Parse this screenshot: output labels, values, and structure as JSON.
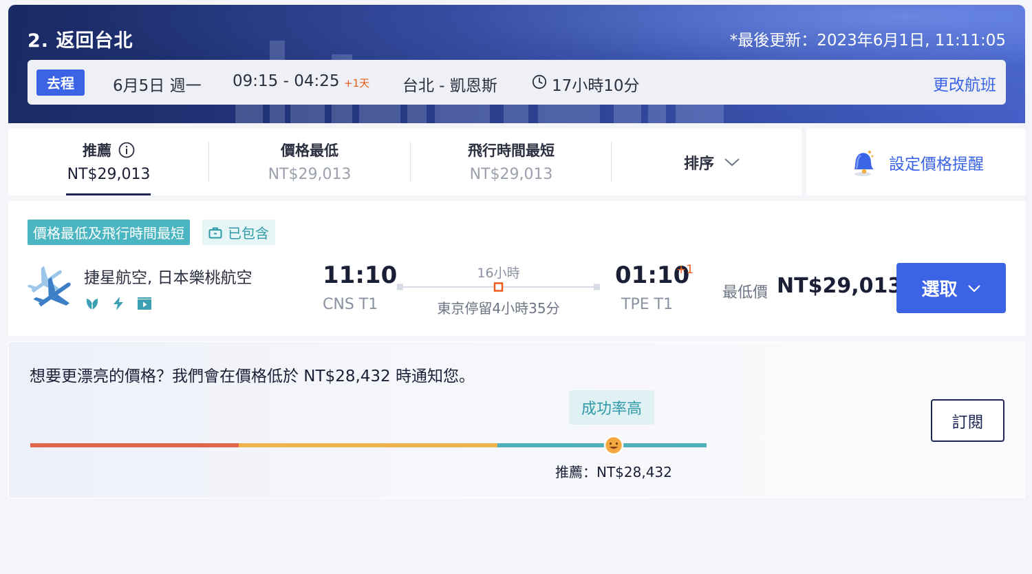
{
  "header": {
    "title": "2. 返回台北",
    "last_updated": "*最後更新：2023年6月1日, 11:11:05",
    "trip": {
      "badge": "去程",
      "date": "6月5日 週一",
      "time_range": "09:15 - 04:25",
      "next_day": "+1天",
      "route": "台北 - 凱恩斯",
      "duration": "17小時10分",
      "change_flight": "更改航班"
    }
  },
  "tabs": [
    {
      "label": "推薦",
      "price": "NT$29,013",
      "active": true
    },
    {
      "label": "價格最低",
      "price": "NT$29,013"
    },
    {
      "label": "飛行時間最短",
      "price": "NT$29,013"
    }
  ],
  "sort": {
    "label": "排序"
  },
  "price_alert_button": {
    "label": "設定價格提醒"
  },
  "flight": {
    "tag_best": "價格最低及飛行時間最短",
    "tag_included": "已包含",
    "airlines": "捷星航空, 日本樂桃航空",
    "amenity_icons": [
      "leaf-icon",
      "power-icon",
      "entertainment-icon"
    ],
    "departure_time": "11:10",
    "departure_airport": "CNS T1",
    "total_duration": "16小時",
    "stopover": "東京停留4小時35分",
    "arrival_time": "01:10",
    "arrival_next_day": "+1",
    "arrival_airport": "TPE T1",
    "price_label": "最低價",
    "price": "NT$29,013",
    "select_label": "選取"
  },
  "price_watch": {
    "message": "想要更漂亮的價格？我們會在價格低於 NT$28,432 時通知您。",
    "success_label": "成功率高",
    "recommend_label": "推薦：NT$28,432",
    "subscribe_label": "訂閱"
  },
  "colors": {
    "accent": "#3b63e6",
    "teal": "#4bb6c2",
    "orange": "#ea5b18",
    "bar_red": "#e0654a",
    "bar_orange": "#f0b34b",
    "bar_teal": "#4fb0bc"
  }
}
